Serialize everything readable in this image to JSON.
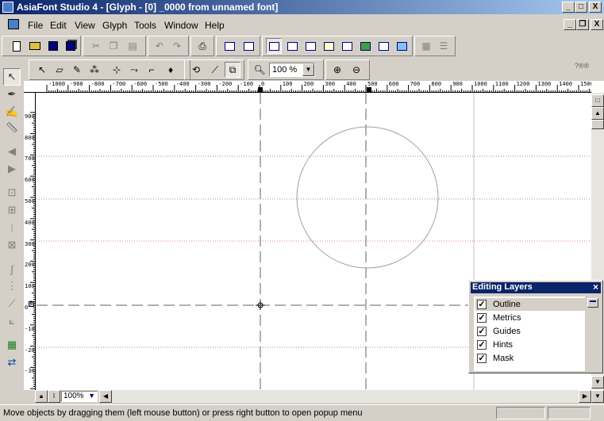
{
  "window": {
    "title": "AsiaFont Studio 4 - [Glyph - [0] _0000 from unnamed font]",
    "buttons": {
      "minimize": "_",
      "maximize": "□",
      "close": "X"
    }
  },
  "menubar": {
    "items": [
      {
        "label": "File",
        "key": "file"
      },
      {
        "label": "Edit",
        "key": "edit"
      },
      {
        "label": "View",
        "key": "view"
      },
      {
        "label": "Glyph",
        "key": "glyph"
      },
      {
        "label": "Tools",
        "key": "tools"
      },
      {
        "label": "Window",
        "key": "window"
      },
      {
        "label": "Help",
        "key": "help"
      }
    ],
    "child_buttons": {
      "minimize": "_",
      "restore": "❐",
      "close": "X"
    }
  },
  "toolbar2": {
    "zoom_value": "100 %",
    "help_glyphs": "?®®"
  },
  "rulers": {
    "horizontal_labels": [
      "-1000",
      "-900",
      "-800",
      "-700",
      "-600",
      "-500",
      "-400",
      "-300",
      "-200",
      "-100",
      "0",
      "100",
      "200",
      "300",
      "400",
      "500",
      "600",
      "700",
      "800",
      "900",
      "1000",
      "1100",
      "1200",
      "1300",
      "1400",
      "1500"
    ],
    "vertical_labels": [
      "900",
      "800",
      "700",
      "600",
      "500",
      "400",
      "300",
      "200",
      "100",
      "0",
      "-100",
      "-200",
      "-300",
      "-400"
    ],
    "markers": {
      "c": "C",
      "x": "X",
      "b": "B",
      "d": "D"
    }
  },
  "bottombar": {
    "zoom": "100%"
  },
  "layers_panel": {
    "title": "Editing Layers",
    "close": "×",
    "layers": [
      {
        "label": "Outline",
        "checked": true
      },
      {
        "label": "Metrics",
        "checked": true
      },
      {
        "label": "Guides",
        "checked": true
      },
      {
        "label": "Hints",
        "checked": true
      },
      {
        "label": "Mask",
        "checked": true
      }
    ]
  },
  "statusbar": {
    "message": "Move objects by dragging them (left mouse button) or press right button to open popup menu"
  },
  "colors": {
    "title_start": "#0a246a",
    "title_end": "#a6caf0",
    "guide_red": "#e08080",
    "guide_gray": "#808080"
  }
}
